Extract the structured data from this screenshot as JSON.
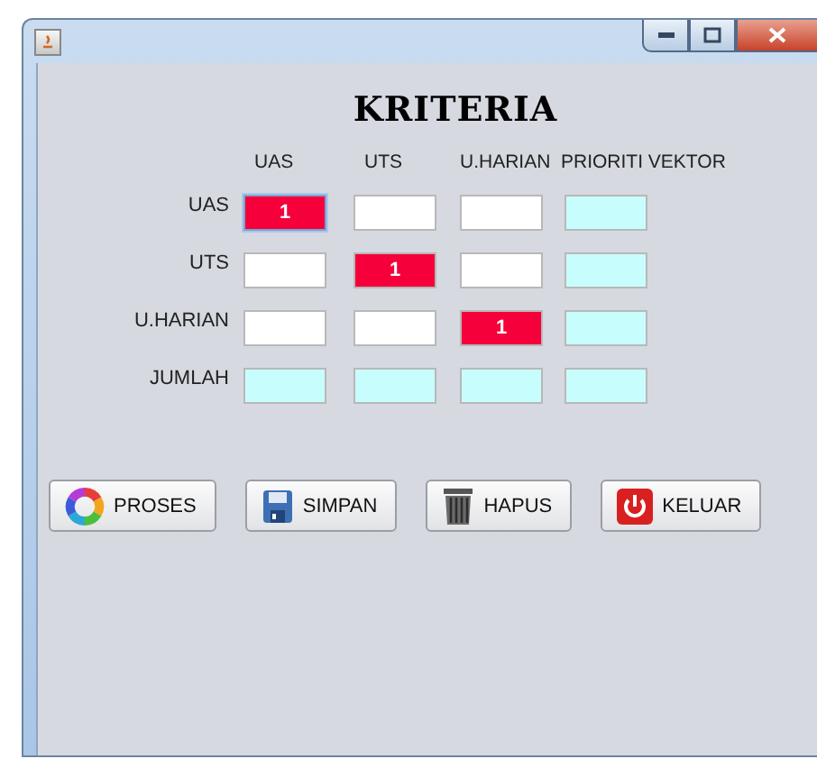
{
  "heading": "KRITERIA",
  "columns": [
    "UAS",
    "UTS",
    "U.HARIAN",
    "PRIORITI VEKTOR"
  ],
  "rows": [
    {
      "label": "UAS",
      "cells": [
        {
          "kind": "highlight",
          "value": "1",
          "focused": true
        },
        {
          "kind": "input",
          "focused": false
        },
        {
          "kind": "input",
          "focused": false
        },
        {
          "kind": "result",
          "focused": false
        }
      ]
    },
    {
      "label": "UTS",
      "cells": [
        {
          "kind": "input",
          "focused": false
        },
        {
          "kind": "highlight",
          "value": "1",
          "focused": false
        },
        {
          "kind": "input",
          "focused": false
        },
        {
          "kind": "result",
          "focused": false
        }
      ]
    },
    {
      "label": "U.HARIAN",
      "cells": [
        {
          "kind": "input",
          "focused": false
        },
        {
          "kind": "input",
          "focused": false
        },
        {
          "kind": "highlight",
          "value": "1",
          "focused": false
        },
        {
          "kind": "result",
          "focused": false
        }
      ]
    },
    {
      "label": "JUMLAH",
      "cells": [
        {
          "kind": "result",
          "focused": false
        },
        {
          "kind": "result",
          "focused": false
        },
        {
          "kind": "result",
          "focused": false
        },
        {
          "kind": "result",
          "focused": false
        }
      ]
    }
  ],
  "buttons": [
    "PROSES",
    "SIMPAN",
    "HAPUS",
    "KELUAR"
  ]
}
